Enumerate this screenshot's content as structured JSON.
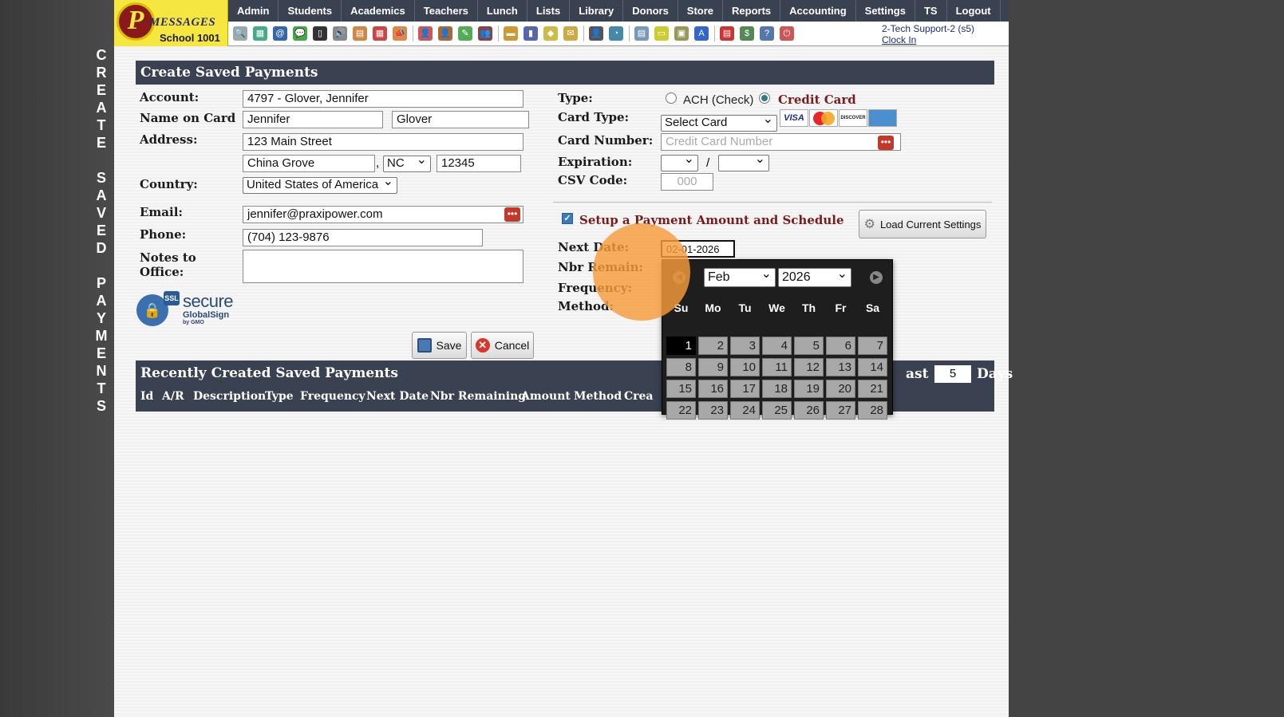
{
  "vertical_title": "CREATE SAVED PAYMENTS",
  "logo": {
    "letter": "P",
    "brand": "MESSAGES",
    "school": "School 1001"
  },
  "menu": [
    "Admin",
    "Students",
    "Academics",
    "Teachers",
    "Lunch",
    "Lists",
    "Library",
    "Donors",
    "Store",
    "Reports",
    "Accounting",
    "Settings",
    "TS",
    "Logout"
  ],
  "user": {
    "name": "2-Tech Support-2 (s5)",
    "clock_link": "Clock In"
  },
  "form": {
    "title": "Create Saved Payments",
    "account_label": "Account:",
    "account_value": "4797 - Glover, Jennifer",
    "name_label": "Name on Card",
    "first_name": "Jennifer",
    "last_name": "Glover",
    "address_label": "Address:",
    "address": "123 Main Street",
    "city": "China Grove",
    "comma": ",",
    "state": "NC",
    "zip": "12345",
    "country_label": "Country:",
    "country": "United States of America",
    "email_label": "Email:",
    "email": "jennifer@praxipower.com",
    "phone_label": "Phone:",
    "phone": "(704) 123-9876",
    "notes_label_1": "Notes to",
    "notes_label_2": "Office:",
    "notes_value": "",
    "ssl": {
      "badge": "SSL",
      "secure": "secure",
      "globalsign": "GlobalSign",
      "by": "by GMO"
    },
    "save": "Save",
    "cancel": "Cancel"
  },
  "payment": {
    "type_label": "Type:",
    "ach_label": "ACH (Check)",
    "credit_label": "Credit Card",
    "card_type_label": "Card Type:",
    "card_type_value": "Select Card",
    "card_brands": [
      "VISA",
      "MasterCard",
      "DISCOVER",
      "AMEX"
    ],
    "card_number_label": "Card Number:",
    "card_number_placeholder": "Credit Card Number",
    "expiration_label": "Expiration:",
    "exp_sep": "/",
    "csv_label": "CSV Code:",
    "csv_placeholder": "000",
    "schedule_label": "Setup a Payment Amount and Schedule",
    "load_settings": "Load Current Settings",
    "next_date_label": "Next Date:",
    "next_date_value": "02-01-2026",
    "nbr_remain_label": "Nbr Remain:",
    "frequency_label": "Frequency:",
    "method_label": "Method:"
  },
  "calendar": {
    "month": "Feb",
    "year": "2026",
    "days_of_week": [
      "Su",
      "Mo",
      "Tu",
      "We",
      "Th",
      "Fr",
      "Sa"
    ],
    "weeks": [
      [
        "",
        "",
        "",
        "",
        "",
        "",
        ""
      ],
      [
        "1",
        "2",
        "3",
        "4",
        "5",
        "6",
        "7"
      ],
      [
        "8",
        "9",
        "10",
        "11",
        "12",
        "13",
        "14"
      ],
      [
        "15",
        "16",
        "17",
        "18",
        "19",
        "20",
        "21"
      ],
      [
        "22",
        "23",
        "24",
        "25",
        "26",
        "27",
        "28"
      ]
    ]
  },
  "recent": {
    "title": "Recently Created Saved Payments",
    "last_label": "ast",
    "days_value": "5",
    "days_label": "Days",
    "columns": [
      "Id",
      "A/R",
      "Description",
      "Type",
      "Frequency",
      "Next Date",
      "Nbr Remaining",
      "Amount",
      "Method",
      "Crea"
    ]
  },
  "colors": {
    "header": "#3a4150",
    "accent_red": "#8a1a1a",
    "logo_yellow": "#f5e640",
    "highlight": "#f79b3c"
  }
}
